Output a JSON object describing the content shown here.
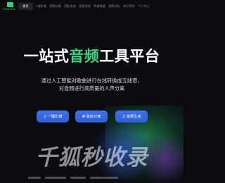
{
  "brand": {
    "logo_text": "FireAudio",
    "accent_color": "#2fd37f"
  },
  "nav": {
    "items": [
      {
        "label": "首页",
        "active": true
      },
      {
        "label": "一键扒谱"
      },
      {
        "label": "音频分离"
      },
      {
        "label": "音轨合成"
      },
      {
        "label": "音高检测"
      },
      {
        "label": "转调变速"
      },
      {
        "label": "音频分析"
      },
      {
        "label": "关于我们"
      },
      {
        "label": "个人中心"
      }
    ]
  },
  "hero": {
    "title_prefix": "一站式",
    "title_accent": "音频",
    "title_suffix": "工具平台",
    "subtitle_line1": "通过人工智能对歌曲进行在线转换成五线谱，",
    "subtitle_line2": "对音频进行高质量的人声分离"
  },
  "buttons": {
    "btn1": {
      "icon": "♫",
      "label": "一键扒谱"
    },
    "btn2": {
      "icon": "✚",
      "label": "音轨分离"
    },
    "btn3": {
      "icon": "♫",
      "label": "音频生成"
    },
    "color": "#3468e4"
  },
  "watermark": {
    "text": "千狐秒收录"
  }
}
